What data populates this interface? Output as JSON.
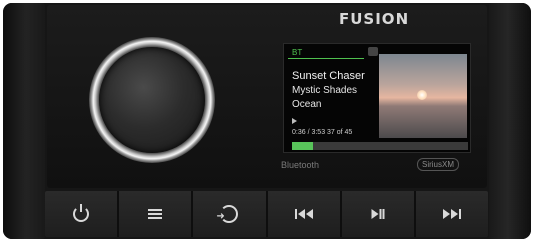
{
  "device": {
    "brand": "FUSION"
  },
  "screen": {
    "source": "BT",
    "title": "Sunset Chaser",
    "artist": "Mystic Shades",
    "album": "Ocean",
    "time": "0:36 / 3:53 37 of 45",
    "progress_fraction": 0.12,
    "accent_color": "#58c45a"
  },
  "logos": {
    "bluetooth": "Bluetooth",
    "siriusxm": "SiriusXM"
  },
  "buttons": [
    {
      "icon": "power-icon"
    },
    {
      "icon": "menu-icon"
    },
    {
      "icon": "source-icon"
    },
    {
      "icon": "previous-icon"
    },
    {
      "icon": "play-pause-icon"
    },
    {
      "icon": "next-icon"
    }
  ]
}
